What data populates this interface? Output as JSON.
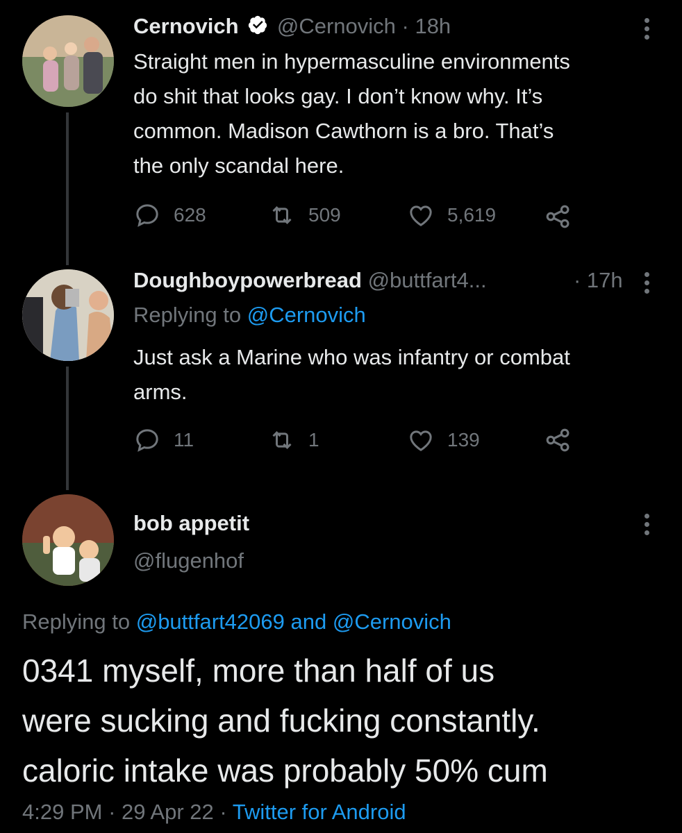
{
  "tweet1": {
    "display_name": "Cernovich",
    "handle": "@Cernovich",
    "time": "· 18h",
    "text_lines": [
      "Straight men in hypermasculine environments",
      "do shit that looks gay. I don’t know why. It’s",
      "common. Madison Cawthorn is a bro. That’s",
      "the only scandal here."
    ],
    "replies": "628",
    "retweets": "509",
    "likes": "5,619"
  },
  "tweet2": {
    "display_name": "Doughboypowerbread",
    "handle": "@buttfart4...",
    "time": "· 17h",
    "replying_prefix": "Replying to ",
    "replying_to": "@Cernovich",
    "text_lines": [
      "Just ask a Marine who was infantry or combat",
      "arms."
    ],
    "replies": "11",
    "retweets": "1",
    "likes": "139"
  },
  "tweet3": {
    "display_name": "bob appetit",
    "handle": "@flugenhof",
    "replying_prefix": "Replying to ",
    "replying_to_1": "@buttfart42069",
    "replying_and": " and ",
    "replying_to_2": "@Cernovich",
    "text_lines": [
      "0341 myself, more than half of us",
      "were sucking and fucking constantly.",
      "caloric intake was probably 50% cum"
    ],
    "time": "4:29 PM",
    "sep1": " · ",
    "date": "29 Apr 22",
    "sep2": " · ",
    "source": "Twitter for Android"
  },
  "colors": {
    "background": "#000000",
    "text": "#e7e9ea",
    "muted": "#71767b",
    "link": "#1d9bf0",
    "verified": "#ffffff"
  }
}
